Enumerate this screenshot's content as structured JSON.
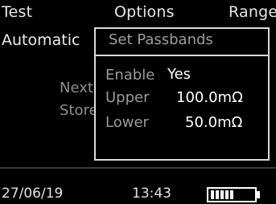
{
  "menu": {
    "test": "Test",
    "options": "Options",
    "range": "Range"
  },
  "mode": "Automatic",
  "background": {
    "next": "Next",
    "store": "Store"
  },
  "dialog": {
    "title": "Set Passbands",
    "enable_label": "Enable",
    "enable_value": "Yes",
    "upper_label": "Upper",
    "upper_value": "100.0mΩ",
    "lower_label": "Lower",
    "lower_value": "50.0mΩ"
  },
  "status": {
    "date": "27/06/19",
    "time": "13:43",
    "battery_segments": 5,
    "battery_level": 0.55
  },
  "colors": {
    "background": "#000000",
    "foreground": "#ffffff"
  }
}
